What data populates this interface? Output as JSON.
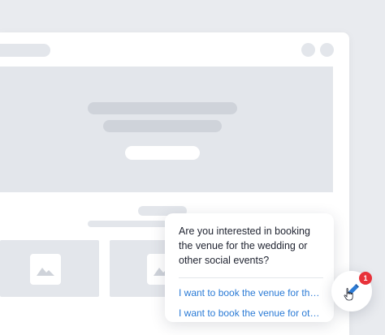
{
  "chat": {
    "question": "Are you interested in booking the venue for the wedding or other social events?",
    "options": [
      "I want to book the venue for the wedding",
      "I want to book the venue for other social events"
    ]
  },
  "launcher": {
    "icon": "pencil-icon",
    "badge_count": "1",
    "accent_color": "#2b7bd6",
    "badge_color": "#e8323a"
  }
}
